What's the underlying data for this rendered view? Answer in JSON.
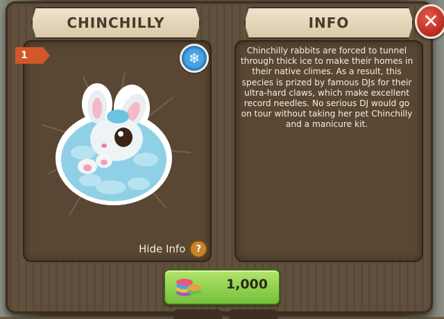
{
  "pet": {
    "name": "CHINCHILLY",
    "count": "1",
    "icon": "snowflake-icon"
  },
  "info": {
    "title": "INFO",
    "description": "Chinchilly rabbits are forced to tunnel through thick ice to make their homes in their native climes. As a result, this species is prized by famous DJs for their ultra-hard claws, which make excellent record needles.  No serious DJ would go on tour without taking her pet Chinchilly and a manicure kit."
  },
  "actions": {
    "hide_info": "Hide Info",
    "help_icon": "?",
    "close_icon": "✕"
  },
  "price": {
    "amount": "1,000",
    "currency_icon": "gem-coins-icon"
  },
  "colors": {
    "panel": "#5e4c39",
    "banner": "#eee3cd",
    "close": "#c43a2c",
    "price_button": "#8fd04c",
    "count_tab": "#d2572a"
  }
}
